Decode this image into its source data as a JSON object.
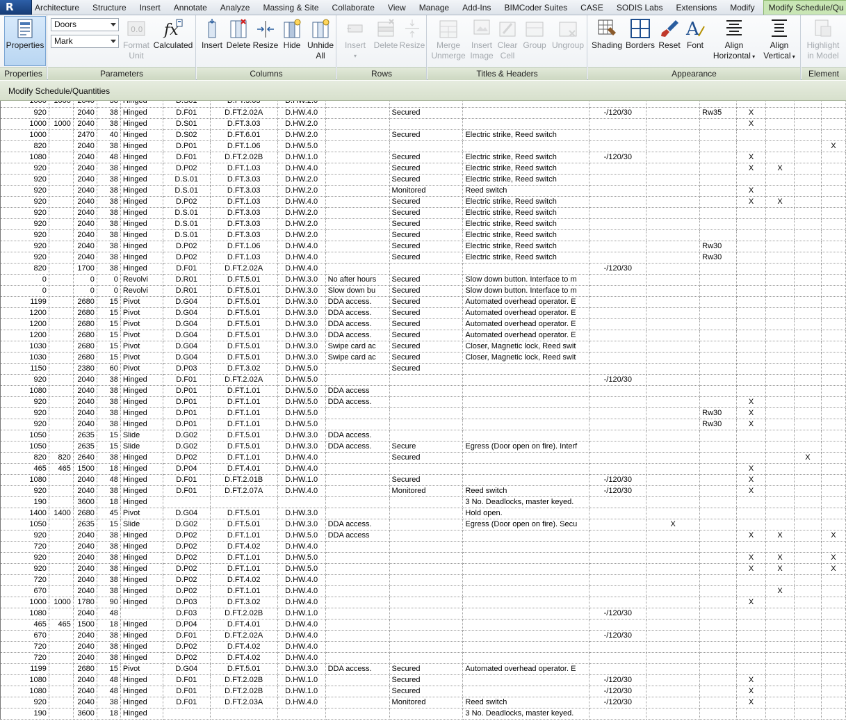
{
  "tabs": [
    "Architecture",
    "Structure",
    "Insert",
    "Annotate",
    "Analyze",
    "Massing & Site",
    "Collaborate",
    "View",
    "Manage",
    "Add-Ins",
    "BIMCoder Suites",
    "CASE",
    "SODIS Labs",
    "Extensions",
    "Modify",
    "Modify Schedule/Qu"
  ],
  "app_button_letter": "R",
  "panels": {
    "properties": {
      "title": "Properties",
      "button": "Properties"
    },
    "parameters": {
      "title": "Parameters",
      "combo1": "Doors",
      "combo2": "Mark",
      "format_unit_line1": "Format",
      "format_unit_line2": "Unit",
      "calculated": "Calculated"
    },
    "columns": {
      "title": "Columns",
      "insert": "Insert",
      "delete": "Delete",
      "resize": "Resize",
      "hide": "Hide",
      "unhide_line1": "Unhide",
      "unhide_line2": "All"
    },
    "rows": {
      "title": "Rows",
      "insert": "Insert",
      "delete": "Delete",
      "resize": "Resize"
    },
    "titles": {
      "title": "Titles & Headers",
      "merge_line1": "Merge",
      "merge_line2": "Unmerge",
      "insert_image_line1": "Insert",
      "insert_image_line2": "Image",
      "clear_line1": "Clear",
      "clear_line2": "Cell",
      "group": "Group",
      "ungroup": "Ungroup"
    },
    "appearance": {
      "title": "Appearance",
      "shading": "Shading",
      "borders": "Borders",
      "reset": "Reset",
      "font": "Font",
      "align_h_line1": "Align",
      "align_h_line2": "Horizontal",
      "align_v_line1": "Align",
      "align_v_line2": "Vertical"
    },
    "element": {
      "title": "Element",
      "highlight_line1": "Highlight",
      "highlight_line2": "in Model"
    }
  },
  "options_bar": "Modify Schedule/Quantities",
  "rows": [
    [
      "1000",
      "1000",
      "2040",
      "38",
      "Hinged",
      "D.S01",
      "D.FT.3.03",
      "D.HW.2.0",
      "",
      "",
      "",
      "",
      "",
      "",
      "",
      ""
    ],
    [
      "920",
      "",
      "2040",
      "38",
      "Hinged",
      "D.F01",
      "D.FT.2.02A",
      "D.HW.4.0",
      "",
      "Secured",
      "",
      "-/120/30",
      "",
      "Rw35",
      "X",
      ""
    ],
    [
      "1000",
      "1000",
      "2040",
      "38",
      "Hinged",
      "D.S01",
      "D.FT.3.03",
      "D.HW.2.0",
      "",
      "",
      "",
      "",
      "",
      "",
      "X",
      ""
    ],
    [
      "1000",
      "",
      "2470",
      "40",
      "Hinged",
      "D.S02",
      "D.FT.6.01",
      "D.HW.2.0",
      "",
      "Secured",
      "Electric strike, Reed switch",
      "",
      "",
      "",
      "",
      ""
    ],
    [
      "820",
      "",
      "2040",
      "38",
      "Hinged",
      "D.P01",
      "D.FT.1.06",
      "D.HW.5.0",
      "",
      "",
      "",
      "",
      "",
      "",
      "",
      "",
      "",
      "X"
    ],
    [
      "1080",
      "",
      "2040",
      "48",
      "Hinged",
      "D.F01",
      "D.FT.2.02B",
      "D.HW.1.0",
      "",
      "Secured",
      "Electric strike, Reed switch",
      "-/120/30",
      "",
      "",
      "X",
      ""
    ],
    [
      "920",
      "",
      "2040",
      "38",
      "Hinged",
      "D.P02",
      "D.FT.1.03",
      "D.HW.4.0",
      "",
      "Secured",
      "Electric strike, Reed switch",
      "",
      "",
      "",
      "X",
      "X"
    ],
    [
      "920",
      "",
      "2040",
      "38",
      "Hinged",
      "D.S.01",
      "D.FT.3.03",
      "D.HW.2.0",
      "",
      "Secured",
      "Electric strike, Reed switch",
      "",
      "",
      "",
      "",
      ""
    ],
    [
      "920",
      "",
      "2040",
      "38",
      "Hinged",
      "D.S.01",
      "D.FT.3.03",
      "D.HW.2.0",
      "",
      "Monitored",
      "Reed switch",
      "",
      "",
      "",
      "X",
      ""
    ],
    [
      "920",
      "",
      "2040",
      "38",
      "Hinged",
      "D.P02",
      "D.FT.1.03",
      "D.HW.4.0",
      "",
      "Secured",
      "Electric strike, Reed switch",
      "",
      "",
      "",
      "X",
      "X"
    ],
    [
      "920",
      "",
      "2040",
      "38",
      "Hinged",
      "D.S.01",
      "D.FT.3.03",
      "D.HW.2.0",
      "",
      "Secured",
      "Electric strike, Reed switch",
      "",
      "",
      "",
      "",
      ""
    ],
    [
      "920",
      "",
      "2040",
      "38",
      "Hinged",
      "D.S.01",
      "D.FT.3.03",
      "D.HW.2.0",
      "",
      "Secured",
      "Electric strike, Reed switch",
      "",
      "",
      "",
      "",
      ""
    ],
    [
      "920",
      "",
      "2040",
      "38",
      "Hinged",
      "D.S.01",
      "D.FT.3.03",
      "D.HW.2.0",
      "",
      "Secured",
      "Electric strike, Reed switch",
      "",
      "",
      "",
      "",
      ""
    ],
    [
      "920",
      "",
      "2040",
      "38",
      "Hinged",
      "D.P02",
      "D.FT.1.06",
      "D.HW.4.0",
      "",
      "Secured",
      "Electric strike, Reed switch",
      "",
      "",
      "Rw30",
      "",
      ""
    ],
    [
      "920",
      "",
      "2040",
      "38",
      "Hinged",
      "D.P02",
      "D.FT.1.03",
      "D.HW.4.0",
      "",
      "Secured",
      "Electric strike, Reed switch",
      "",
      "",
      "Rw30",
      "",
      ""
    ],
    [
      "820",
      "",
      "1700",
      "38",
      "Hinged",
      "D.F01",
      "D.FT.2.02A",
      "D.HW.4.0",
      "",
      "",
      "",
      "-/120/30",
      "",
      "",
      "",
      ""
    ],
    [
      "0",
      "",
      "0",
      "0",
      "Revolvi",
      "D.R01",
      "D.FT.5.01",
      "D.HW.3.0",
      "No after hours",
      "Secured",
      "Slow down button. Interface to m",
      "",
      "",
      "",
      "",
      ""
    ],
    [
      "0",
      "",
      "0",
      "0",
      "Revolvi",
      "D.R01",
      "D.FT.5.01",
      "D.HW.3.0",
      "Slow down bu",
      "Secured",
      "Slow down button. Interface to m",
      "",
      "",
      "",
      "",
      ""
    ],
    [
      "1199",
      "",
      "2680",
      "15",
      "Pivot",
      "D.G04",
      "D.FT.5.01",
      "D.HW.3.0",
      "DDA access.",
      "Secured",
      "Automated overhead operator. E",
      "",
      "",
      "",
      "",
      ""
    ],
    [
      "1200",
      "",
      "2680",
      "15",
      "Pivot",
      "D.G04",
      "D.FT.5.01",
      "D.HW.3.0",
      "DDA access.",
      "Secured",
      "Automated overhead operator. E",
      "",
      "",
      "",
      "",
      ""
    ],
    [
      "1200",
      "",
      "2680",
      "15",
      "Pivot",
      "D.G04",
      "D.FT.5.01",
      "D.HW.3.0",
      "DDA access.",
      "Secured",
      "Automated overhead operator. E",
      "",
      "",
      "",
      "",
      ""
    ],
    [
      "1200",
      "",
      "2680",
      "15",
      "Pivot",
      "D.G04",
      "D.FT.5.01",
      "D.HW.3.0",
      "DDA access.",
      "Secured",
      "Automated overhead operator. E",
      "",
      "",
      "",
      "",
      ""
    ],
    [
      "1030",
      "",
      "2680",
      "15",
      "Pivot",
      "D.G04",
      "D.FT.5.01",
      "D.HW.3.0",
      "Swipe card ac",
      "Secured",
      "Closer, Magnetic lock, Reed swit",
      "",
      "",
      "",
      "",
      ""
    ],
    [
      "1030",
      "",
      "2680",
      "15",
      "Pivot",
      "D.G04",
      "D.FT.5.01",
      "D.HW.3.0",
      "Swipe card ac",
      "Secured",
      "Closer, Magnetic lock, Reed swit",
      "",
      "",
      "",
      "",
      ""
    ],
    [
      "1150",
      "",
      "2380",
      "60",
      "Pivot",
      "D.P03",
      "D.FT.3.02",
      "D.HW.5.0",
      "",
      "Secured",
      "",
      "",
      "",
      "",
      "",
      ""
    ],
    [
      "920",
      "",
      "2040",
      "38",
      "Hinged",
      "D.F01",
      "D.FT.2.02A",
      "D.HW.5.0",
      "",
      "",
      "",
      "-/120/30",
      "",
      "",
      "",
      ""
    ],
    [
      "1080",
      "",
      "2040",
      "38",
      "Hinged",
      "D.P01",
      "D.FT.1.01",
      "D.HW.5.0",
      "DDA access",
      "",
      "",
      "",
      "",
      "",
      "",
      ""
    ],
    [
      "920",
      "",
      "2040",
      "38",
      "Hinged",
      "D.P01",
      "D.FT.1.01",
      "D.HW.5.0",
      "DDA access.",
      "",
      "",
      "",
      "",
      "",
      "X",
      ""
    ],
    [
      "920",
      "",
      "2040",
      "38",
      "Hinged",
      "D.P01",
      "D.FT.1.01",
      "D.HW.5.0",
      "",
      "",
      "",
      "",
      "",
      "Rw30",
      "X",
      ""
    ],
    [
      "920",
      "",
      "2040",
      "38",
      "Hinged",
      "D.P01",
      "D.FT.1.01",
      "D.HW.5.0",
      "",
      "",
      "",
      "",
      "",
      "Rw30",
      "X",
      ""
    ],
    [
      "1050",
      "",
      "2635",
      "15",
      "Slide",
      "D.G02",
      "D.FT.5.01",
      "D.HW.3.0",
      "DDA access.",
      "",
      "",
      "",
      "",
      "",
      "",
      ""
    ],
    [
      "1050",
      "",
      "2635",
      "15",
      "Slide",
      "D.G02",
      "D.FT.5.01",
      "D.HW.3.0",
      "DDA access.",
      "Secure",
      "Egress (Door open on fire). Interf",
      "",
      "",
      "",
      "",
      ""
    ],
    [
      "820",
      "820",
      "2640",
      "38",
      "Hinged",
      "D.P02",
      "D.FT.1.01",
      "D.HW.4.0",
      "",
      "Secured",
      "",
      "",
      "",
      "",
      "",
      "",
      "X",
      ""
    ],
    [
      "465",
      "465",
      "1500",
      "18",
      "Hinged",
      "D.P04",
      "D.FT.4.01",
      "D.HW.4.0",
      "",
      "",
      "",
      "",
      "",
      "",
      "X",
      ""
    ],
    [
      "1080",
      "",
      "2040",
      "48",
      "Hinged",
      "D.F01",
      "D.FT.2.01B",
      "D.HW.1.0",
      "",
      "Secured",
      "",
      "-/120/30",
      "",
      "",
      "X",
      ""
    ],
    [
      "920",
      "",
      "2040",
      "38",
      "Hinged",
      "D.F01",
      "D.FT.2.07A",
      "D.HW.4.0",
      "",
      "Monitored",
      "Reed switch",
      "-/120/30",
      "",
      "",
      "X",
      ""
    ],
    [
      "190",
      "",
      "3600",
      "18",
      "Hinged",
      "",
      "",
      "",
      "",
      "",
      "3 No. Deadlocks, master keyed.",
      "",
      "",
      "",
      "",
      ""
    ],
    [
      "1400",
      "1400",
      "2680",
      "45",
      "Pivot",
      "D.G04",
      "D.FT.5.01",
      "D.HW.3.0",
      "",
      "",
      "Hold open.",
      "",
      "",
      "",
      "",
      ""
    ],
    [
      "1050",
      "",
      "2635",
      "15",
      "Slide",
      "D.G02",
      "D.FT.5.01",
      "D.HW.3.0",
      "DDA access.",
      "",
      "Egress (Door open on fire). Secu",
      "",
      "X",
      "",
      "",
      ""
    ],
    [
      "920",
      "",
      "2040",
      "38",
      "Hinged",
      "D.P02",
      "D.FT.1.01",
      "D.HW.5.0",
      "DDA access",
      "",
      "",
      "",
      "",
      "",
      "X",
      "X",
      "",
      "X"
    ],
    [
      "720",
      "",
      "2040",
      "38",
      "Hinged",
      "D.P02",
      "D.FT.4.02",
      "D.HW.4.0",
      "",
      "",
      "",
      "",
      "",
      "",
      "",
      ""
    ],
    [
      "920",
      "",
      "2040",
      "38",
      "Hinged",
      "D.P02",
      "D.FT.1.01",
      "D.HW.5.0",
      "",
      "",
      "",
      "",
      "",
      "",
      "X",
      "X",
      "",
      "X"
    ],
    [
      "920",
      "",
      "2040",
      "38",
      "Hinged",
      "D.P02",
      "D.FT.1.01",
      "D.HW.5.0",
      "",
      "",
      "",
      "",
      "",
      "",
      "X",
      "X",
      "",
      "X"
    ],
    [
      "720",
      "",
      "2040",
      "38",
      "Hinged",
      "D.P02",
      "D.FT.4.02",
      "D.HW.4.0",
      "",
      "",
      "",
      "",
      "",
      "",
      "",
      ""
    ],
    [
      "670",
      "",
      "2040",
      "38",
      "Hinged",
      "D.P02",
      "D.FT.1.01",
      "D.HW.4.0",
      "",
      "",
      "",
      "",
      "",
      "",
      "",
      "X"
    ],
    [
      "1000",
      "1000",
      "1780",
      "90",
      "Hinged",
      "D.P03",
      "D.FT.3.02",
      "D.HW.4.0",
      "",
      "",
      "",
      "",
      "",
      "",
      "X",
      ""
    ],
    [
      "1080",
      "",
      "2040",
      "48",
      "",
      "D.F03",
      "D.FT.2.02B",
      "D.HW.1.0",
      "",
      "",
      "",
      "-/120/30",
      "",
      "",
      "",
      ""
    ],
    [
      "465",
      "465",
      "1500",
      "18",
      "Hinged",
      "D.P04",
      "D.FT.4.01",
      "D.HW.4.0",
      "",
      "",
      "",
      "",
      "",
      "",
      "",
      ""
    ],
    [
      "670",
      "",
      "2040",
      "38",
      "Hinged",
      "D.F01",
      "D.FT.2.02A",
      "D.HW.4.0",
      "",
      "",
      "",
      "-/120/30",
      "",
      "",
      "",
      ""
    ],
    [
      "720",
      "",
      "2040",
      "38",
      "Hinged",
      "D.P02",
      "D.FT.4.02",
      "D.HW.4.0",
      "",
      "",
      "",
      "",
      "",
      "",
      "",
      ""
    ],
    [
      "720",
      "",
      "2040",
      "38",
      "Hinged",
      "D.P02",
      "D.FT.4.02",
      "D.HW.4.0",
      "",
      "",
      "",
      "",
      "",
      "",
      "",
      ""
    ],
    [
      "1199",
      "",
      "2680",
      "15",
      "Pivot",
      "D.G04",
      "D.FT.5.01",
      "D.HW.3.0",
      "DDA access.",
      "Secured",
      "Automated overhead operator. E",
      "",
      "",
      "",
      "",
      ""
    ],
    [
      "1080",
      "",
      "2040",
      "48",
      "Hinged",
      "D.F01",
      "D.FT.2.02B",
      "D.HW.1.0",
      "",
      "Secured",
      "",
      "-/120/30",
      "",
      "",
      "X",
      ""
    ],
    [
      "1080",
      "",
      "2040",
      "48",
      "Hinged",
      "D.F01",
      "D.FT.2.02B",
      "D.HW.1.0",
      "",
      "Secured",
      "",
      "-/120/30",
      "",
      "",
      "X",
      ""
    ],
    [
      "920",
      "",
      "2040",
      "38",
      "Hinged",
      "D.F01",
      "D.FT.2.03A",
      "D.HW.4.0",
      "",
      "Monitored",
      "Reed switch",
      "-/120/30",
      "",
      "",
      "X",
      ""
    ],
    [
      "190",
      "",
      "3600",
      "18",
      "Hinged",
      "",
      "",
      "",
      "",
      "",
      "3 No. Deadlocks, master keyed.",
      "",
      "",
      "",
      "",
      ""
    ]
  ]
}
